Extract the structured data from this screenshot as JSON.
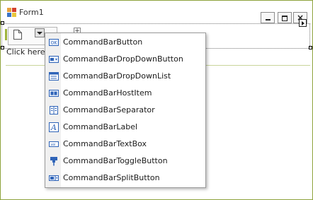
{
  "window": {
    "title": "Form1"
  },
  "design_surface": {
    "hint_text": "Click here t"
  },
  "commandbar_menu": {
    "items": [
      {
        "label": "CommandBarButton",
        "icon": "button-icon"
      },
      {
        "label": "CommandBarDropDownButton",
        "icon": "dropdown-button-icon"
      },
      {
        "label": "CommandBarDropDownList",
        "icon": "dropdown-list-icon"
      },
      {
        "label": "CommandBarHostItem",
        "icon": "host-item-icon"
      },
      {
        "label": "CommandBarSeparator",
        "icon": "separator-icon"
      },
      {
        "label": "CommandBarLabel",
        "icon": "label-icon"
      },
      {
        "label": "CommandBarTextBox",
        "icon": "textbox-icon"
      },
      {
        "label": "CommandBarToggleButton",
        "icon": "toggle-button-icon"
      },
      {
        "label": "CommandBarSplitButton",
        "icon": "split-button-icon"
      }
    ]
  },
  "colors": {
    "form_border": "#8ea33d",
    "grip": "#9fb43d",
    "icon_blue": "#2f64b8"
  }
}
